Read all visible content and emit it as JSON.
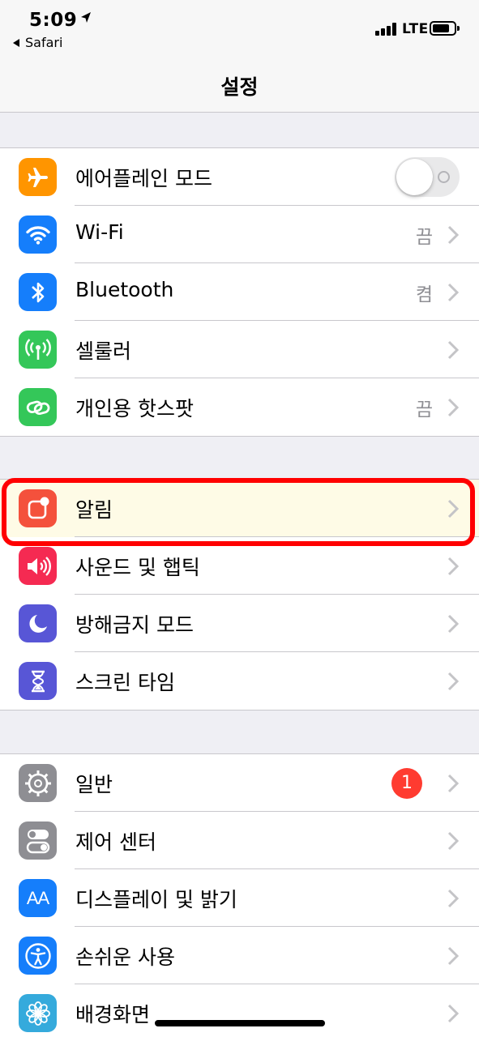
{
  "status_bar": {
    "time": "5:09",
    "back_app": "Safari",
    "network": "LTE"
  },
  "nav": {
    "title": "설정"
  },
  "groups": [
    {
      "rows": [
        {
          "label": "에어플레인 모드",
          "icon": "airplane-icon",
          "icon_color": "#ff9500",
          "accessory": "toggle",
          "toggle_on": false
        },
        {
          "label": "Wi-Fi",
          "icon": "wifi-icon",
          "icon_color": "#157efb",
          "detail": "끔"
        },
        {
          "label": "Bluetooth",
          "icon": "bluetooth-icon",
          "icon_color": "#157efb",
          "detail": "켬"
        },
        {
          "label": "셀룰러",
          "icon": "cellular-antenna-icon",
          "icon_color": "#34c759"
        },
        {
          "label": "개인용 핫스팟",
          "icon": "hotspot-chain-icon",
          "icon_color": "#34c759",
          "detail": "끔"
        }
      ]
    },
    {
      "rows": [
        {
          "label": "알림",
          "icon": "notifications-icon",
          "icon_color": "#f4513c",
          "highlighted": true
        },
        {
          "label": "사운드 및 햅틱",
          "icon": "speaker-icon",
          "icon_color": "#f52a52"
        },
        {
          "label": "방해금지 모드",
          "icon": "moon-icon",
          "icon_color": "#5856d6"
        },
        {
          "label": "스크린 타임",
          "icon": "hourglass-icon",
          "icon_color": "#5856d6"
        }
      ]
    },
    {
      "rows": [
        {
          "label": "일반",
          "icon": "gear-icon",
          "icon_color": "#8e8e93",
          "badge": "1"
        },
        {
          "label": "제어 센터",
          "icon": "switches-icon",
          "icon_color": "#8e8e93"
        },
        {
          "label": "디스플레이 및 밝기",
          "icon": "text-size-icon",
          "icon_color": "#157efb"
        },
        {
          "label": "손쉬운 사용",
          "icon": "accessibility-icon",
          "icon_color": "#157efb"
        },
        {
          "label": "배경화면",
          "icon": "flower-icon",
          "icon_color": "#35aadc"
        }
      ]
    }
  ],
  "icon_glyphs": {
    "text-size-icon": "AA"
  }
}
